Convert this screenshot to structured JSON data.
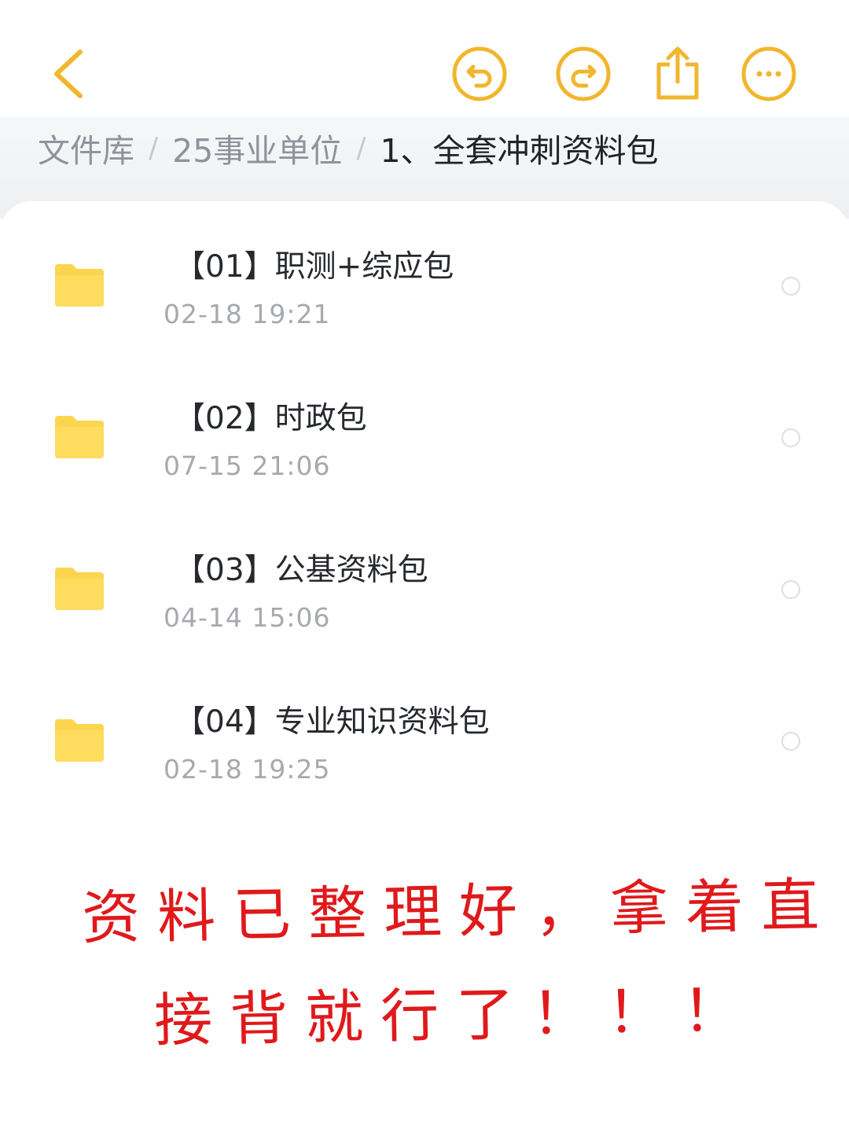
{
  "header": {
    "back_icon": "chevron-left-icon",
    "actions": [
      "undo-icon",
      "redo-icon",
      "share-icon",
      "more-icon"
    ],
    "accent_color": "#f1b62e"
  },
  "breadcrumb": {
    "items": [
      "文件库",
      "25事业单位",
      "1、全套冲刺资料包"
    ],
    "separator": "/"
  },
  "files": [
    {
      "name": "【01】职测+综应包",
      "date": "02-18  19:21"
    },
    {
      "name": "【02】时政包",
      "date": "07-15  21:06"
    },
    {
      "name": "【03】公基资料包",
      "date": "04-14  15:06"
    },
    {
      "name": "【04】专业知识资料包",
      "date": "02-18  19:25"
    }
  ],
  "folder_color": "#fcd54e",
  "overlay": {
    "line1": "资料已整理好，拿着直",
    "line2": "接背就行了！！！",
    "color": "#e0191b"
  }
}
